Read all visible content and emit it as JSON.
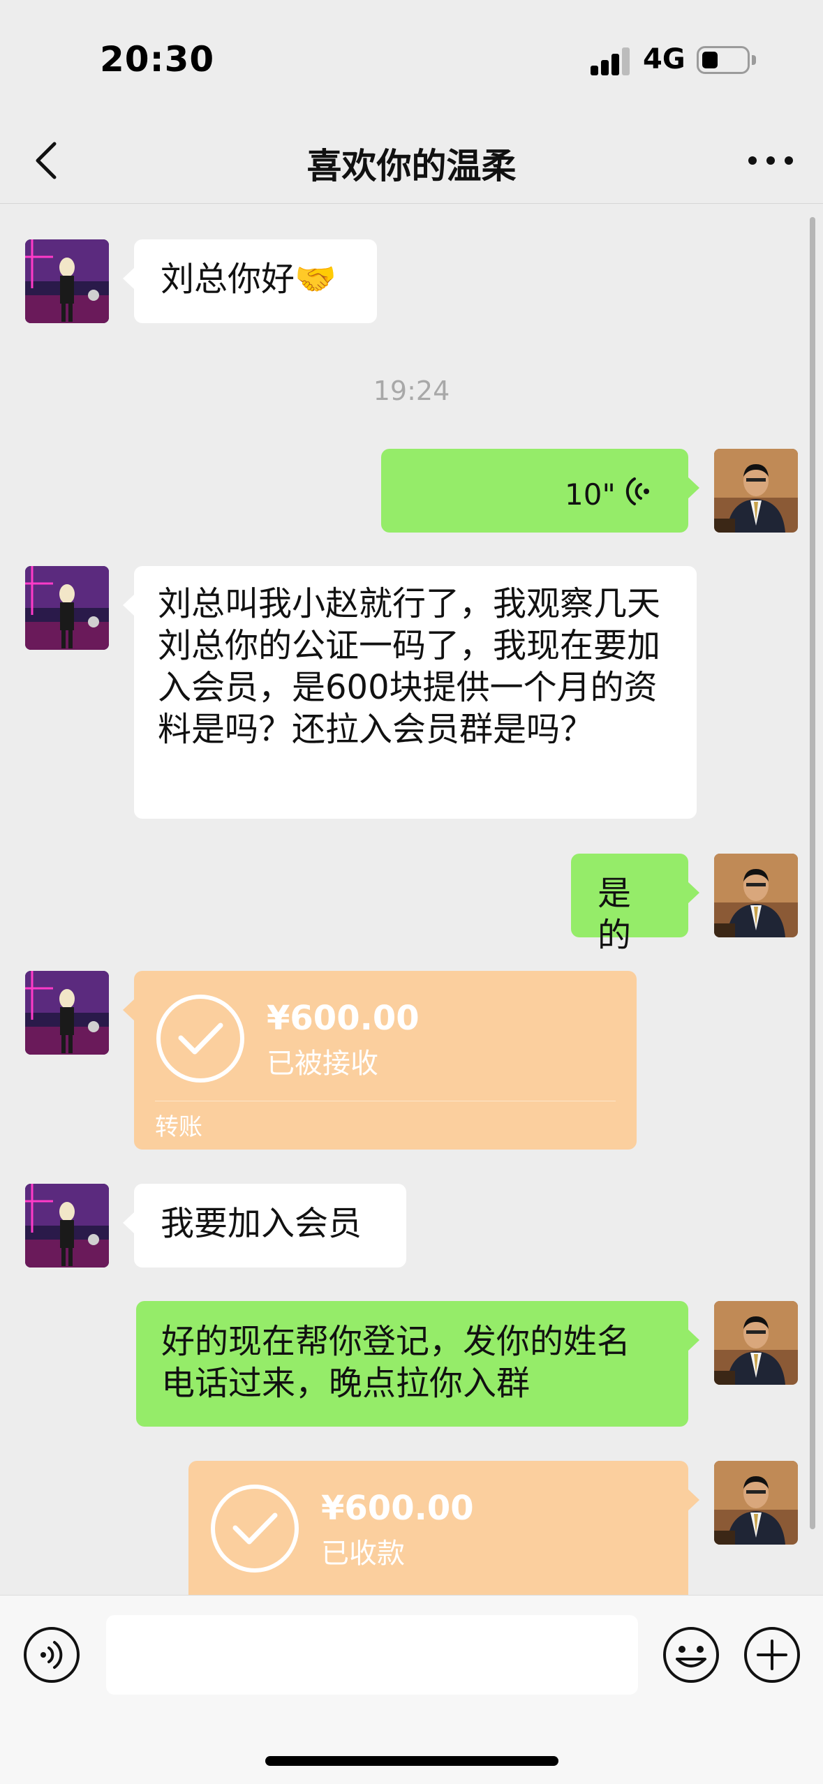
{
  "status_bar": {
    "time": "20:30",
    "network": "4G"
  },
  "header": {
    "title": "喜欢你的温柔",
    "back_icon": "chevron-left-icon",
    "more_icon": "ellipsis-icon"
  },
  "colors": {
    "background": "#ededed",
    "sent_bubble": "#95ec69",
    "received_bubble": "#ffffff",
    "transfer_card": "#fbcf9e",
    "timestamp_text": "#a8a8a8"
  },
  "messages": [
    {
      "side": "left",
      "type": "text",
      "text": "刘总你好🤝"
    },
    {
      "type": "timestamp",
      "text": "19:24"
    },
    {
      "side": "right",
      "type": "voice",
      "duration": "10\""
    },
    {
      "side": "left",
      "type": "text",
      "text": "刘总叫我小赵就行了，我观察几天刘总你的公证一码了，我现在要加入会员，是600块提供一个月的资料是吗？还拉入会员群是吗？"
    },
    {
      "side": "right",
      "type": "text",
      "text": "是的"
    },
    {
      "side": "left",
      "type": "transfer",
      "amount": "¥600.00",
      "status": "已被接收",
      "label": "转账"
    },
    {
      "side": "left",
      "type": "text",
      "text": "我要加入会员"
    },
    {
      "side": "right",
      "type": "text",
      "text": "好的现在帮你登记，发你的姓名电话过来，晚点拉你入群"
    },
    {
      "side": "right",
      "type": "transfer",
      "amount": "¥600.00",
      "status": "已收款"
    }
  ],
  "input_bar": {
    "voice_icon": "voice-toggle-icon",
    "emoji_icon": "emoji-icon",
    "plus_icon": "plus-icon"
  }
}
